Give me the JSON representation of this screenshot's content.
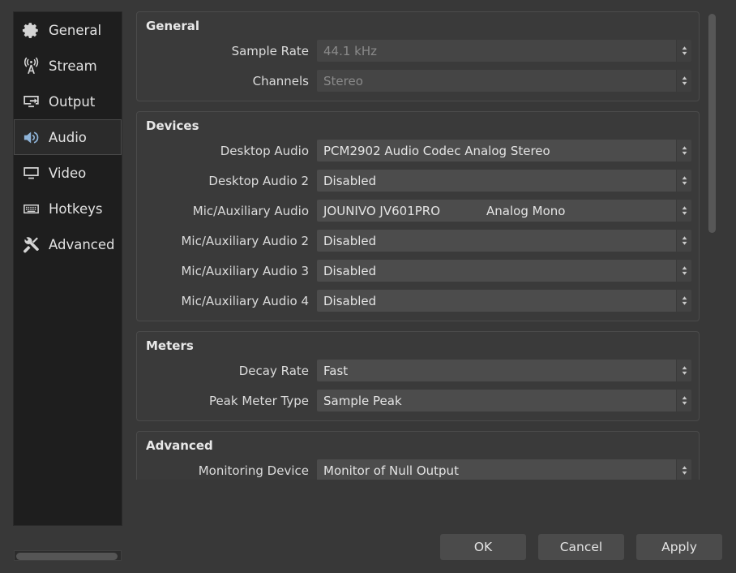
{
  "sidebar": {
    "items": [
      {
        "label": "General",
        "icon": "gear-icon",
        "selected": false
      },
      {
        "label": "Stream",
        "icon": "broadcast-icon",
        "selected": false
      },
      {
        "label": "Output",
        "icon": "monitor-out-icon",
        "selected": false
      },
      {
        "label": "Audio",
        "icon": "speaker-icon",
        "selected": true
      },
      {
        "label": "Video",
        "icon": "monitor-icon",
        "selected": false
      },
      {
        "label": "Hotkeys",
        "icon": "keyboard-icon",
        "selected": false
      },
      {
        "label": "Advanced",
        "icon": "tools-icon",
        "selected": false
      }
    ]
  },
  "groups": [
    {
      "title": "General",
      "rows": [
        {
          "label": "Sample Rate",
          "value": "44.1 kHz",
          "secondary": "",
          "disabled": true
        },
        {
          "label": "Channels",
          "value": "Stereo",
          "secondary": "",
          "disabled": true
        }
      ]
    },
    {
      "title": "Devices",
      "rows": [
        {
          "label": "Desktop Audio",
          "value": "PCM2902 Audio Codec Analog Stereo",
          "secondary": "",
          "disabled": false
        },
        {
          "label": "Desktop Audio 2",
          "value": "Disabled",
          "secondary": "",
          "disabled": false
        },
        {
          "label": "Mic/Auxiliary Audio",
          "value": "JOUNIVO JV601PRO",
          "secondary": "Analog Mono",
          "disabled": false
        },
        {
          "label": "Mic/Auxiliary Audio 2",
          "value": "Disabled",
          "secondary": "",
          "disabled": false
        },
        {
          "label": "Mic/Auxiliary Audio 3",
          "value": "Disabled",
          "secondary": "",
          "disabled": false
        },
        {
          "label": "Mic/Auxiliary Audio 4",
          "value": "Disabled",
          "secondary": "",
          "disabled": false
        }
      ]
    },
    {
      "title": "Meters",
      "rows": [
        {
          "label": "Decay Rate",
          "value": "Fast",
          "secondary": "",
          "disabled": false
        },
        {
          "label": "Peak Meter Type",
          "value": "Sample Peak",
          "secondary": "",
          "disabled": false
        }
      ]
    },
    {
      "title": "Advanced",
      "rows": [
        {
          "label": "Monitoring Device",
          "value": "Monitor of Null Output",
          "secondary": "",
          "disabled": false
        }
      ]
    }
  ],
  "buttons": {
    "ok": "OK",
    "cancel": "Cancel",
    "apply": "Apply"
  },
  "colors": {
    "window_bg": "#383838",
    "sidebar_bg": "#1e1e1e",
    "group_bg": "#3a3a3a",
    "combo_bg": "#4c4c4c",
    "accent_icon": "#8fb4d9",
    "text": "#e2e2e2"
  }
}
